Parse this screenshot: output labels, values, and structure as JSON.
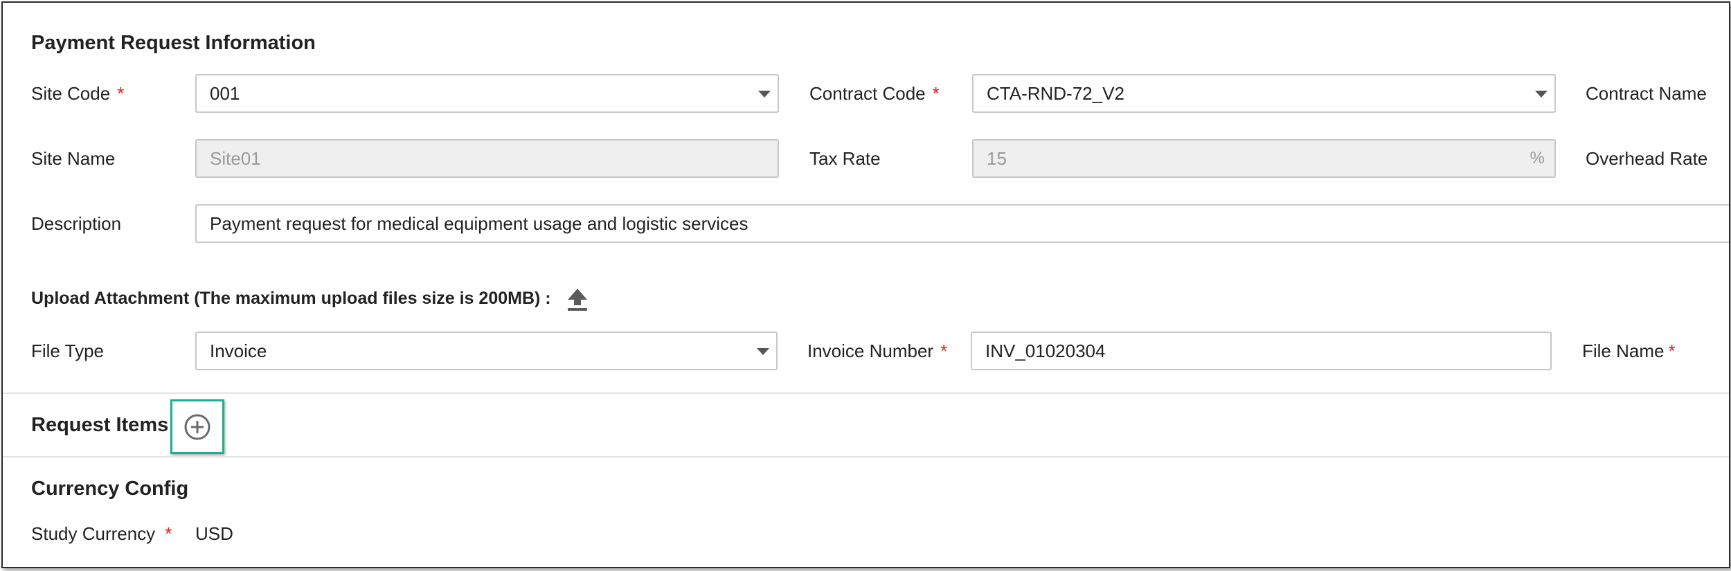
{
  "payment_request": {
    "title": "Payment Request Information",
    "site_code": {
      "label": "Site Code",
      "required": "*",
      "value": "001"
    },
    "contract_code": {
      "label": "Contract Code",
      "required": "*",
      "value": "CTA-RND-72_V2"
    },
    "contract_name": {
      "label": "Contract Name"
    },
    "site_name": {
      "label": "Site Name",
      "value": "Site01"
    },
    "tax_rate": {
      "label": "Tax Rate",
      "value": "15",
      "suffix": "%"
    },
    "overhead_rate": {
      "label": "Overhead Rate"
    },
    "description": {
      "label": "Description",
      "value": "Payment request for medical equipment usage and logistic services"
    }
  },
  "upload": {
    "label": "Upload Attachment (The maximum upload files size is 200MB) :",
    "icon": "upload-icon"
  },
  "file": {
    "file_type": {
      "label": "File Type",
      "value": "Invoice"
    },
    "invoice_number": {
      "label": "Invoice Number",
      "required": "*",
      "value": "INV_01020304"
    },
    "file_name": {
      "label": "File Name",
      "required": "*"
    }
  },
  "request_items": {
    "title": "Request Items",
    "icon": "add-circle-icon"
  },
  "currency": {
    "title": "Currency Config",
    "study_currency": {
      "label": "Study Currency",
      "required": "*",
      "value": "USD"
    }
  },
  "colors": {
    "required": "#d9251d",
    "highlight": "#1fae91",
    "disabled_bg": "#efefef"
  }
}
